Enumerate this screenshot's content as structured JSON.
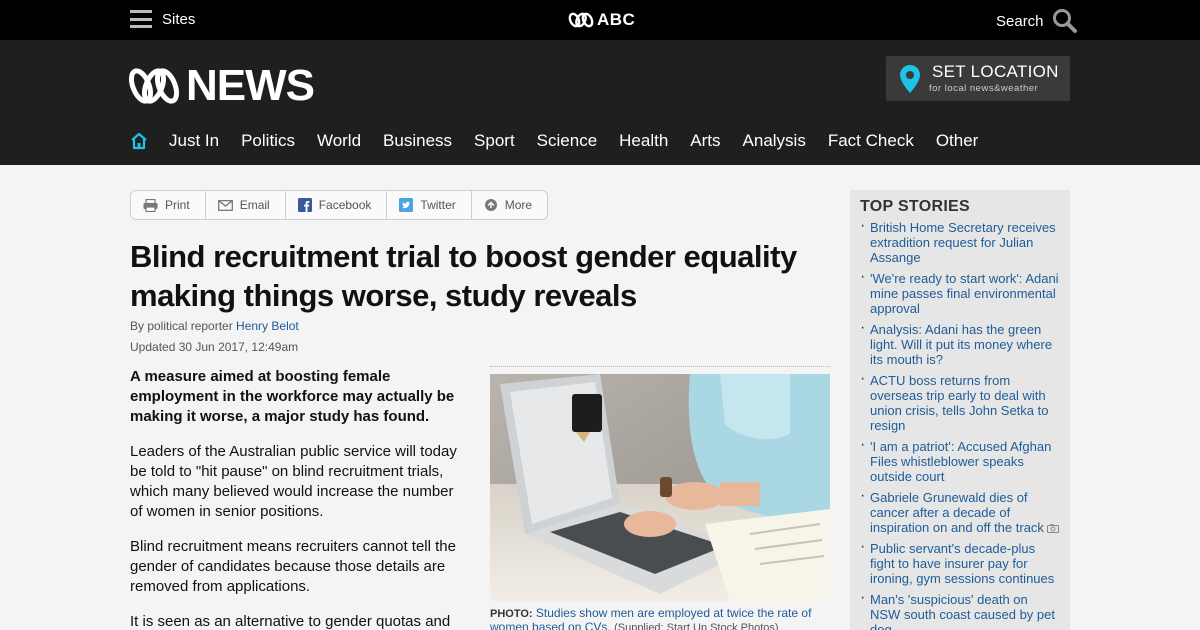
{
  "topbar": {
    "sites_label": "Sites",
    "brand": "ABC",
    "search_label": "Search"
  },
  "header": {
    "logo_text": "NEWS",
    "location_title": "SET LOCATION",
    "location_subtitle": "for local news&weather",
    "nav": [
      "Just In",
      "Politics",
      "World",
      "Business",
      "Sport",
      "Science",
      "Health",
      "Arts",
      "Analysis",
      "Fact Check",
      "Other"
    ]
  },
  "share": {
    "print": "Print",
    "email": "Email",
    "facebook": "Facebook",
    "twitter": "Twitter",
    "more": "More"
  },
  "article": {
    "headline": "Blind recruitment trial to boost gender equality making things worse, study reveals",
    "byline_prefix": "By political reporter ",
    "author": "Henry Belot",
    "updated": "Updated 30 Jun 2017, 12:49am",
    "paragraphs": [
      "A measure aimed at boosting female employment in the workforce may actually be making it worse, a major study has found.",
      "Leaders of the Australian public service will today be told to \"hit pause\" on blind recruitment trials, which many believed would increase the number of women in senior positions.",
      "Blind recruitment means recruiters cannot tell the gender of candidates because those details are removed from applications.",
      "It is seen as an alternative to gender quotas and"
    ],
    "photo_label": "PHOTO:",
    "photo_caption": "Studies show men are employed at twice the rate of women based on CVs.",
    "photo_credit": "(Supplied: Start Up Stock Photos)"
  },
  "sidebar": {
    "title": "TOP STORIES",
    "stories": [
      "British Home Secretary receives extradition request for Julian Assange",
      "'We're ready to start work': Adani mine passes final environmental approval",
      "Analysis: Adani has the green light. Will it put its money where its mouth is?",
      "ACTU boss returns from overseas trip early to deal with union crisis, tells John Setka to resign",
      "'I am a patriot': Accused Afghan Files whistleblower speaks outside court",
      "Gabriele Grunewald dies of cancer after a decade of inspiration on and off the track",
      "Public servant's decade-plus fight to have insurer pay for ironing, gym sessions continues",
      "Man's 'suspicious' death on NSW south coast caused by pet dog"
    ]
  },
  "colors": {
    "topbar_bg": "#000000",
    "header_bg": "#1f1f1f",
    "link_blue": "#1e5c99",
    "accent_cyan": "#1ec3e8",
    "sidebar_bg": "#e6e6e6"
  },
  "icons": [
    "menu-icon",
    "abc-logo-icon",
    "search-icon",
    "location-pin-icon",
    "home-icon",
    "print-icon",
    "email-icon",
    "facebook-icon",
    "twitter-icon",
    "more-icon",
    "camera-icon"
  ]
}
